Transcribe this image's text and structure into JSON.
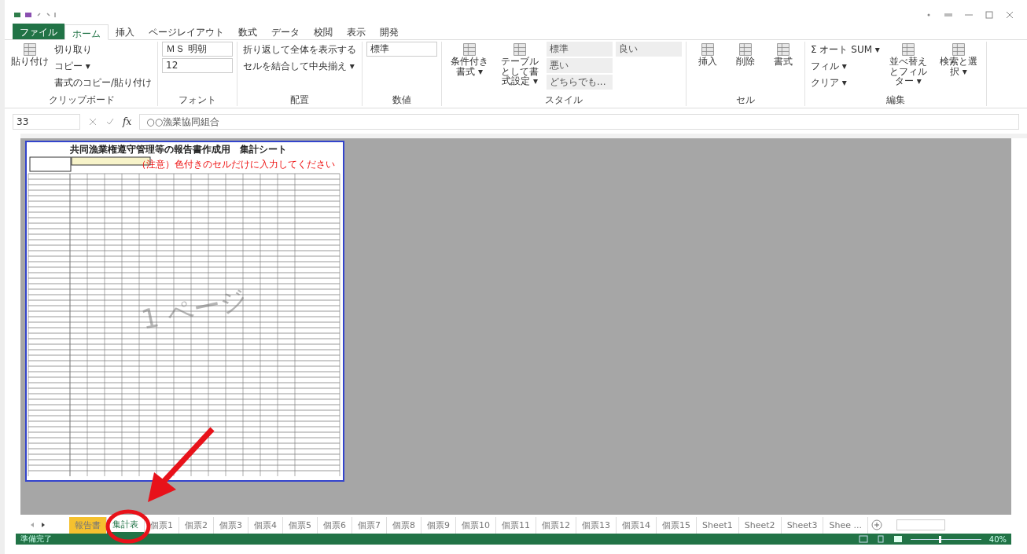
{
  "ribbon_tabs": [
    {
      "label": "ファイル",
      "kind": "file",
      "selected": false
    },
    {
      "label": "ホーム",
      "kind": "tab",
      "selected": true
    },
    {
      "label": "挿入",
      "kind": "tab",
      "selected": false
    },
    {
      "label": "ページレイアウト",
      "kind": "tab",
      "selected": false
    },
    {
      "label": "数式",
      "kind": "tab",
      "selected": false
    },
    {
      "label": "データ",
      "kind": "tab",
      "selected": false
    },
    {
      "label": "校閲",
      "kind": "tab",
      "selected": false
    },
    {
      "label": "表示",
      "kind": "tab",
      "selected": false
    },
    {
      "label": "開発",
      "kind": "tab",
      "selected": false
    }
  ],
  "ribbon_groups": [
    {
      "label": "クリップボード",
      "items": [
        {
          "kind": "large",
          "label": "貼り付け"
        },
        {
          "kind": "small",
          "label": "切り取り"
        },
        {
          "kind": "small",
          "label": "コピー ▾"
        },
        {
          "kind": "small",
          "label": "書式のコピー/貼り付け"
        }
      ]
    },
    {
      "label": "フォント",
      "items": [
        {
          "kind": "field",
          "label": "ＭＳ 明朝"
        },
        {
          "kind": "field",
          "label": "12"
        }
      ]
    },
    {
      "label": "配置",
      "items": [
        {
          "kind": "small",
          "label": "折り返して全体を表示する"
        },
        {
          "kind": "small",
          "label": "セルを結合して中央揃え ▾"
        }
      ]
    },
    {
      "label": "数値",
      "items": [
        {
          "kind": "field",
          "label": "標準"
        }
      ]
    },
    {
      "label": "スタイル",
      "items": [
        {
          "kind": "large",
          "label": "条件付き書式 ▾"
        },
        {
          "kind": "large",
          "label": "テーブルとして書式設定 ▾"
        },
        {
          "kind": "style",
          "label": "標準"
        },
        {
          "kind": "style",
          "label": "悪い"
        },
        {
          "kind": "style",
          "label": "どちらでも..."
        },
        {
          "kind": "style",
          "label": "良い"
        }
      ]
    },
    {
      "label": "セル",
      "items": [
        {
          "kind": "large",
          "label": "挿入"
        },
        {
          "kind": "large",
          "label": "削除"
        },
        {
          "kind": "large",
          "label": "書式"
        }
      ]
    },
    {
      "label": "編集",
      "items": [
        {
          "kind": "small",
          "label": "Σ オート SUM ▾"
        },
        {
          "kind": "small",
          "label": "フィル ▾"
        },
        {
          "kind": "small",
          "label": "クリア ▾"
        },
        {
          "kind": "large",
          "label": "並べ替えとフィルター ▾"
        },
        {
          "kind": "large",
          "label": "検索と選択 ▾"
        }
      ]
    }
  ],
  "formula_bar": {
    "name_box": "33",
    "function_label": "fx",
    "formula": "○○漁業協同組合"
  },
  "sheet": {
    "title": "共同漁業権遵守管理等の報告書作成用　集計シート",
    "note": "（注意）色付きのセルだけに入力してください",
    "watermark": "1 ページ"
  },
  "sheet_tabs": [
    {
      "label": "報告書",
      "selected": false,
      "color": "#f5c12f"
    },
    {
      "label": "集計表",
      "selected": true
    },
    {
      "label": "個票1",
      "selected": false
    },
    {
      "label": "個票2",
      "selected": false
    },
    {
      "label": "個票3",
      "selected": false
    },
    {
      "label": "個票4",
      "selected": false
    },
    {
      "label": "個票5",
      "selected": false
    },
    {
      "label": "個票6",
      "selected": false
    },
    {
      "label": "個票7",
      "selected": false
    },
    {
      "label": "個票8",
      "selected": false
    },
    {
      "label": "個票9",
      "selected": false
    },
    {
      "label": "個票10",
      "selected": false
    },
    {
      "label": "個票11",
      "selected": false
    },
    {
      "label": "個票12",
      "selected": false
    },
    {
      "label": "個票13",
      "selected": false
    },
    {
      "label": "個票14",
      "selected": false
    },
    {
      "label": "個票15",
      "selected": false
    },
    {
      "label": "Sheet1",
      "selected": false
    },
    {
      "label": "Sheet2",
      "selected": false
    },
    {
      "label": "Sheet3",
      "selected": false
    },
    {
      "label": "Shee ...",
      "selected": false
    }
  ],
  "status_bar": {
    "status": "準備完了",
    "zoom": {
      "level": 0.4,
      "reading": "40%"
    }
  }
}
